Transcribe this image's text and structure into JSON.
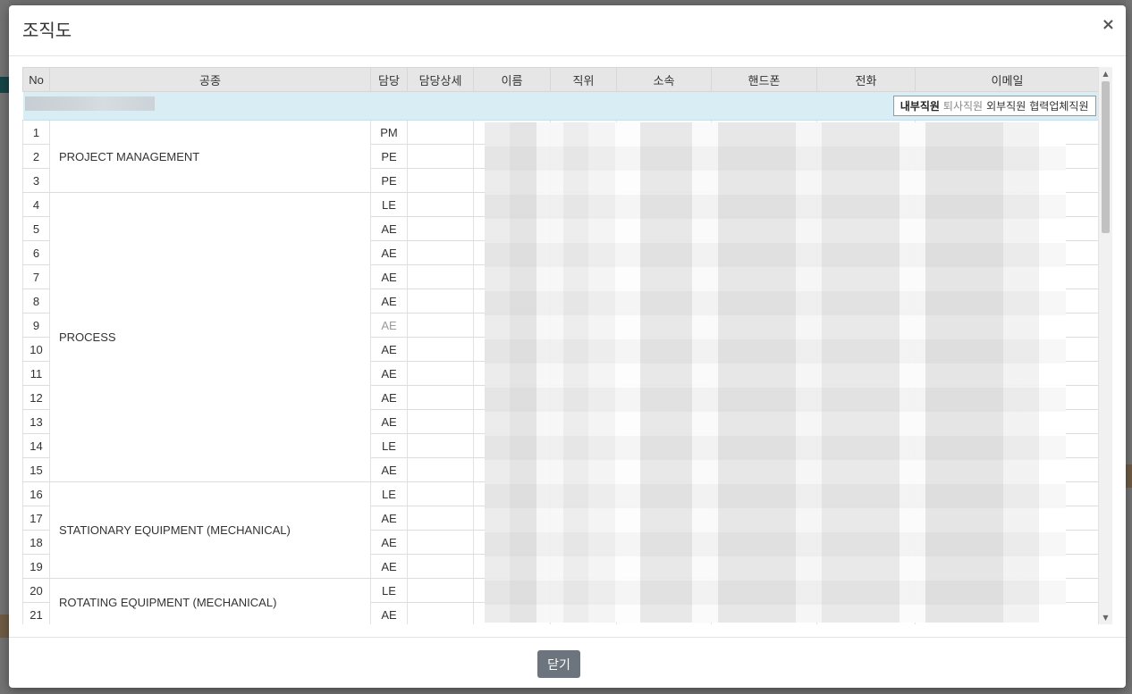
{
  "modal": {
    "title": "조직도",
    "close_symbol": "×",
    "footer_close_label": "닫기"
  },
  "table": {
    "columns": [
      "No",
      "공종",
      "담당",
      "담당상세",
      "이름",
      "직위",
      "소속",
      "핸드폰",
      "전화",
      "이메일"
    ],
    "filter_toggles": [
      {
        "label": "내부직원",
        "state": "active"
      },
      {
        "label": "퇴사직원",
        "state": "inactive"
      },
      {
        "label": "외부직원",
        "state": "plain"
      },
      {
        "label": "협력업체직원",
        "state": "plain"
      }
    ],
    "groups": [
      {
        "trade": "PROJECT MANAGEMENT",
        "rows": [
          {
            "no": "1",
            "role": "PM"
          },
          {
            "no": "2",
            "role": "PE"
          },
          {
            "no": "3",
            "role": "PE"
          }
        ]
      },
      {
        "trade": "PROCESS",
        "rows": [
          {
            "no": "4",
            "role": "LE"
          },
          {
            "no": "5",
            "role": "AE"
          },
          {
            "no": "6",
            "role": "AE"
          },
          {
            "no": "7",
            "role": "AE"
          },
          {
            "no": "8",
            "role": "AE"
          },
          {
            "no": "9",
            "role": "AE",
            "dim": true
          },
          {
            "no": "10",
            "role": "AE"
          },
          {
            "no": "11",
            "role": "AE"
          },
          {
            "no": "12",
            "role": "AE"
          },
          {
            "no": "13",
            "role": "AE"
          },
          {
            "no": "14",
            "role": "LE"
          },
          {
            "no": "15",
            "role": "AE"
          }
        ]
      },
      {
        "trade": "STATIONARY EQUIPMENT (MECHANICAL)",
        "rows": [
          {
            "no": "16",
            "role": "LE"
          },
          {
            "no": "17",
            "role": "AE"
          },
          {
            "no": "18",
            "role": "AE"
          },
          {
            "no": "19",
            "role": "AE"
          }
        ]
      },
      {
        "trade": "ROTATING EQUIPMENT (MECHANICAL)",
        "rows": [
          {
            "no": "20",
            "role": "LE"
          },
          {
            "no": "21",
            "role": "AE"
          }
        ]
      }
    ]
  }
}
